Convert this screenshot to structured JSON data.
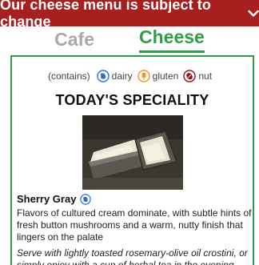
{
  "banner": {
    "text": "Our cheese menu is subject to change"
  },
  "tabs": [
    {
      "label": "Cafe",
      "active": false
    },
    {
      "label": "Cheese",
      "active": true
    }
  ],
  "legend": {
    "contains_label": "(contains)",
    "items": [
      {
        "label": "dairy",
        "icon": "dairy-icon",
        "color": "#2b6fd6"
      },
      {
        "label": "gluten",
        "icon": "gluten-icon",
        "color": "#f0961e"
      },
      {
        "label": "nut",
        "icon": "nut-icon",
        "color": "#8a1a1a"
      }
    ]
  },
  "special": {
    "heading": "TODAY'S SPECIALITY",
    "name": "Sherry Gray",
    "allergen_icon": "dairy-icon",
    "description": "Flavors of cultured cream dominate, with subtle hints of fresh button mushrooms and a warm, nutty finish that lingers on the palate",
    "serving": "Serve with lightly toasted rosemary-olive oil crostini, or simply enjoy with a cup of herbal tea in the evening."
  },
  "colors": {
    "banner": "#a81f1f",
    "accent": "#2f9e44",
    "inactive_tab": "#a8a8a8"
  }
}
